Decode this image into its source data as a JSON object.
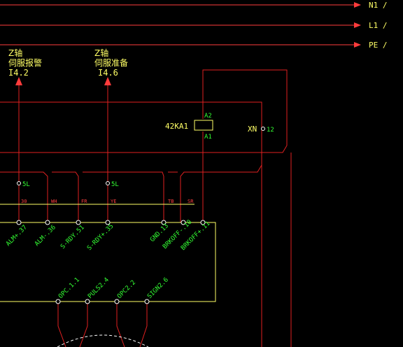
{
  "colors": {
    "background": "#000000",
    "wire": "#e02020",
    "bus": "#ff3b3b",
    "label_yellow": "#ffff66",
    "label_green": "#33ff33",
    "box_outline": "#ffff66",
    "terminal_white": "#ffffff",
    "small_red_text": "#ff4040"
  },
  "bus_lines": [
    {
      "label": "N1 /"
    },
    {
      "label": "L1 /"
    },
    {
      "label": "PE /"
    }
  ],
  "signals": [
    {
      "axis": "Z轴",
      "name": "伺服报警",
      "address": "I4.2"
    },
    {
      "axis": "Z轴",
      "name": "伺服准备",
      "address": "I4.6"
    }
  ],
  "relay": {
    "name": "42KA1",
    "pin_top": "A2",
    "pin_bottom": "A1"
  },
  "xn": {
    "label": "XN",
    "number": "12"
  },
  "terminal_marks": {
    "left": "5L",
    "right": "5L"
  },
  "wire_numbers": [
    "30",
    "WH",
    "FR",
    "YE",
    "TB",
    "SR"
  ],
  "drive_pins": [
    "ALM+.37",
    "ALM-.36",
    "S-RDY.51",
    "S-RDY+.35",
    "GND.13",
    "BRKOFF-.10",
    "BRKOFF+.11"
  ],
  "bottom_pins": [
    "OPC.1.1",
    "PULS2.4",
    "OPC2.2",
    "SIGN2.6"
  ]
}
